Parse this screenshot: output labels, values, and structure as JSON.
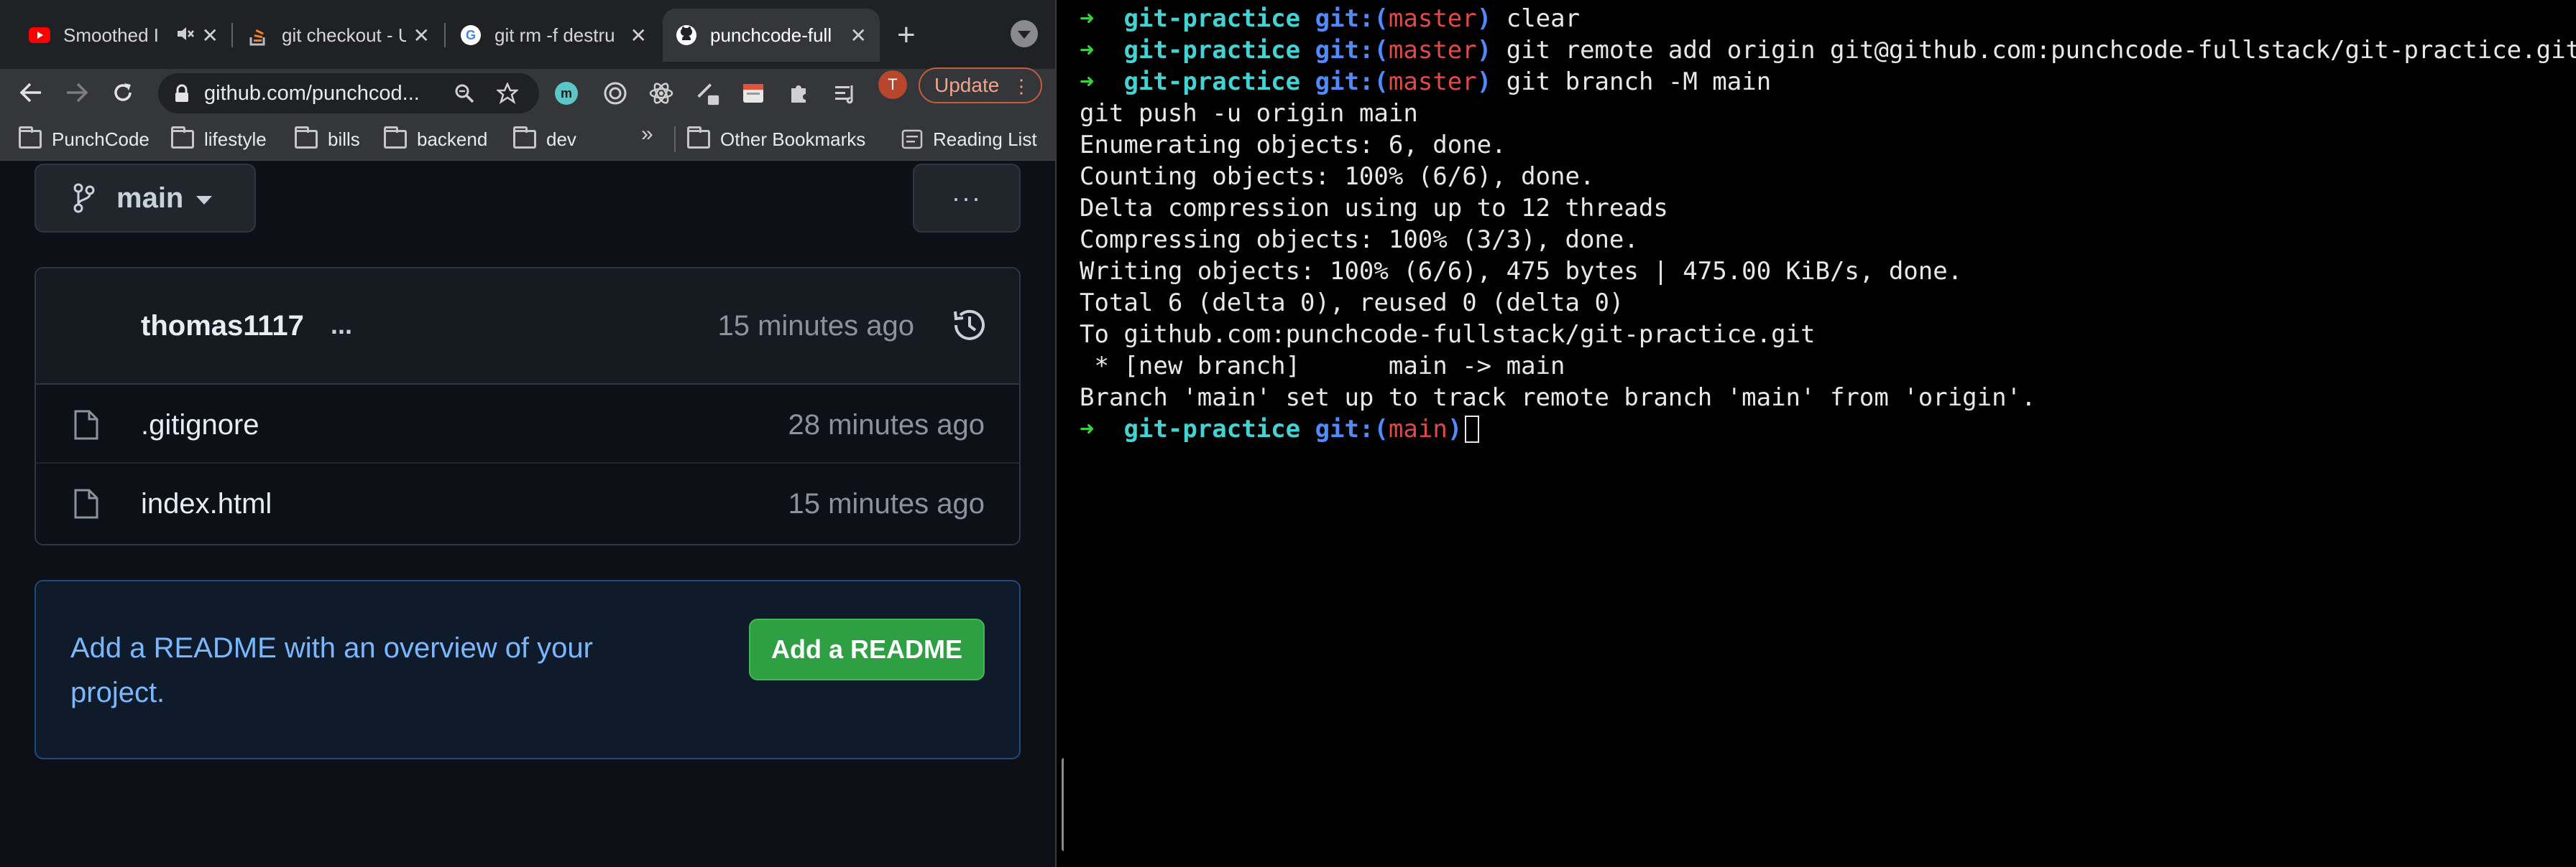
{
  "browser": {
    "tabs": [
      {
        "title": "Smoothed I",
        "icon": "youtube-icon",
        "muted": true
      },
      {
        "title": "git checkout - U",
        "icon": "stackoverflow-icon"
      },
      {
        "title": "git rm -f destru",
        "icon": "google-icon"
      },
      {
        "title": "punchcode-full",
        "icon": "github-icon",
        "active": true
      }
    ],
    "new_tab_label": "+",
    "url": "github.com/punchcod...",
    "profile_initial": "T",
    "update_label": "Update",
    "bookmarks": [
      "PunchCode",
      "lifestyle",
      "bills",
      "backend",
      "dev"
    ],
    "bookmarks_overflow": "»",
    "other_bookmarks": "Other Bookmarks",
    "reading_list": "Reading List"
  },
  "repo": {
    "branch": "main",
    "more_label": "···",
    "commit": {
      "author": "thomas1117",
      "dots": "...",
      "time": "15 minutes ago"
    },
    "files": [
      {
        "name": ".gitignore",
        "time": "28 minutes ago"
      },
      {
        "name": "index.html",
        "time": "15 minutes ago"
      }
    ],
    "readme_prompt": "Add a README with an overview of your project.",
    "readme_button": "Add a README"
  },
  "terminal": {
    "prompt_arrow": "➜",
    "prompt_dir": "git-practice",
    "git_prefix": "git:(",
    "git_suffix": ")",
    "commands": [
      {
        "branch": "master",
        "cmd": "clear"
      },
      {
        "branch": "master",
        "cmd": "git remote add origin git@github.com:punchcode-fullstack/git-practice.git"
      },
      {
        "branch": "master",
        "cmd": "git branch -M main"
      }
    ],
    "output": [
      "git push -u origin main",
      "Enumerating objects: 6, done.",
      "Counting objects: 100% (6/6), done.",
      "Delta compression using up to 12 threads",
      "Compressing objects: 100% (3/3), done.",
      "Writing objects: 100% (6/6), 475 bytes | 475.00 KiB/s, done.",
      "Total 6 (delta 0), reused 0 (delta 0)",
      "To github.com:punchcode-fullstack/git-practice.git",
      " * [new branch]      main -> main",
      "Branch 'main' set up to track remote branch 'main' from 'origin'."
    ],
    "current_branch": "main"
  },
  "colors": {
    "github_bg": "#0d1117",
    "readme_button": "#2ea043",
    "prompt_arrow": "#3fd03f",
    "prompt_dir": "#43d3d3",
    "git_label": "#4f8bff",
    "branch_name": "#e04a4a"
  }
}
